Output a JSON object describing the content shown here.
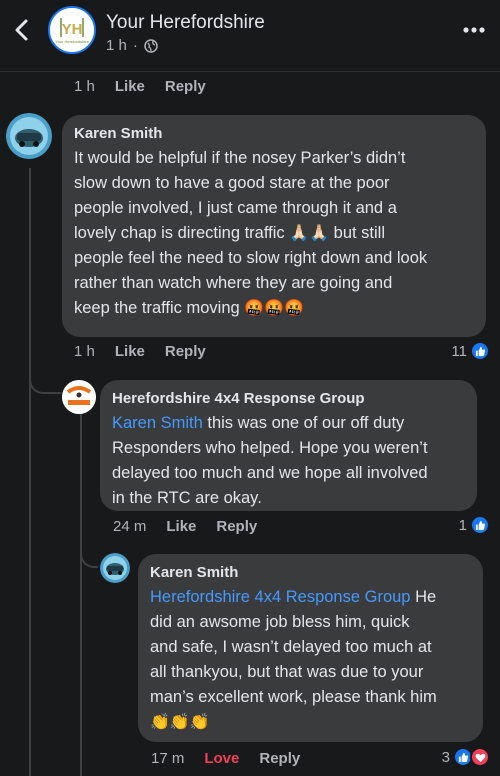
{
  "header": {
    "title": "Your Herefordshire",
    "time": "1 h",
    "separator": "·",
    "avatar_letters": "YH",
    "avatar_caption": "Your Herefordshire"
  },
  "prev_actions": {
    "time": "1 h",
    "like": "Like",
    "reply": "Reply"
  },
  "comments": [
    {
      "author": "Karen Smith",
      "lines": [
        "It would be helpful if the nosey Parker’s didn’t",
        "slow down to have a good stare at the poor",
        "people involved, I just came through it and a",
        "lovely chap is directing traffic",
        "but still",
        "people feel the need to slow right down and look",
        "rather than watch where they are going and",
        "keep the traffic moving"
      ],
      "emoji_pray": "🙏🏻🙏🏻",
      "emoji_angry": "🤬🤬🤬",
      "time": "1 h",
      "like": "Like",
      "reply": "Reply",
      "reaction_count": "11"
    },
    {
      "author": "Herefordshire 4x4 Response Group",
      "mention": "Karen Smith",
      "lines": [
        " this was one of our off duty",
        "Responders who helped. Hope you weren’t",
        "delayed too much and we hope all involved",
        "in the RTC are okay."
      ],
      "time": "24 m",
      "like": "Like",
      "reply": "Reply",
      "reaction_count": "1"
    },
    {
      "author": "Karen Smith",
      "mention": "Herefordshire 4x4 Response Group",
      "lines": [
        " He",
        "did an awsome job bless him, quick",
        "and safe, I wasn’t delayed too much at",
        "all thankyou, but that was due to your",
        "man’s excellent work, please thank him"
      ],
      "emoji_clap": "👏👏👏",
      "time": "17 m",
      "like": "Love",
      "reply": "Reply",
      "reaction_count": "3"
    }
  ],
  "colors": {
    "background": "#18191a",
    "bubble": "#3a3b3c",
    "mention": "#4599ff",
    "like_blue": "#1877f2",
    "love_red": "#f33e58",
    "secondary_text": "#b0b3b8"
  }
}
